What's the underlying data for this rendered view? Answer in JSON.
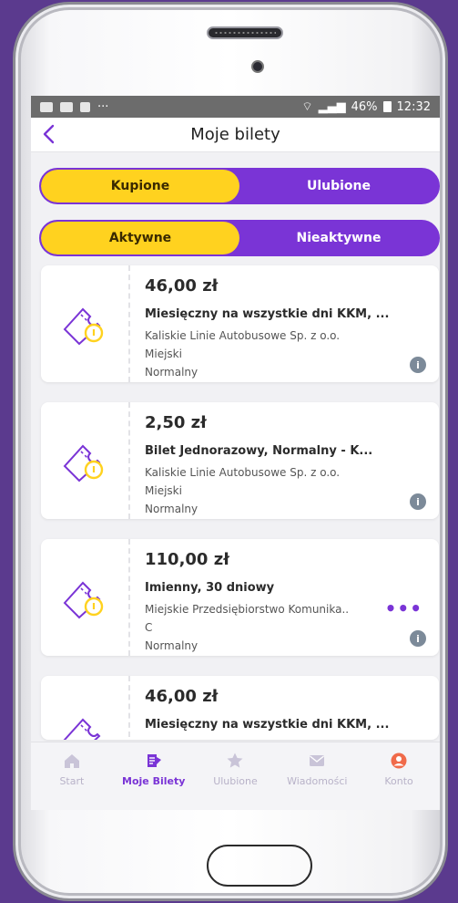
{
  "status_bar": {
    "battery": "46%",
    "time": "12:32",
    "icons": [
      "gallery-icon",
      "message-icon",
      "shopping-bag-icon",
      "more-icon",
      "wifi-icon",
      "signal-icon",
      "battery-icon"
    ]
  },
  "header": {
    "title": "Moje bilety",
    "back_icon": "chevron-left-icon"
  },
  "segment_primary": {
    "options": [
      "Kupione",
      "Ulubione"
    ],
    "selected": "Kupione"
  },
  "segment_secondary": {
    "options": [
      "Aktywne",
      "Nieaktywne"
    ],
    "selected": "Aktywne"
  },
  "tickets": [
    {
      "price": "46,00 zł",
      "name": "Miesięczny na wszystkie dni KKM, ...",
      "operator": "Kaliskie Linie Autobusowe Sp. z o.o.",
      "zone": "Miejski",
      "tariff": "Normalny",
      "info": "i"
    },
    {
      "price": "2,50 zł",
      "name": "Bilet Jednorazowy, Normalny - K...",
      "operator": "Kaliskie Linie Autobusowe Sp. z o.o.",
      "zone": "Miejski",
      "tariff": "Normalny",
      "info": "i"
    },
    {
      "price": "110,00 zł",
      "name": "Imienny, 30 dniowy",
      "operator": "Miejskie Przedsiębiorstwo Komunika..",
      "zone": "C",
      "tariff": "Normalny",
      "info": "i",
      "more": "•••"
    },
    {
      "price": "46,00 zł",
      "name": "Miesięczny na wszystkie dni KKM, ..."
    }
  ],
  "bottom_nav": {
    "items": [
      {
        "label": "Start",
        "icon": "home-icon"
      },
      {
        "label": "Moje Bilety",
        "icon": "tickets-icon"
      },
      {
        "label": "Ulubione",
        "icon": "star-icon"
      },
      {
        "label": "Wiadomości",
        "icon": "mail-icon"
      },
      {
        "label": "Konto",
        "icon": "account-icon"
      }
    ],
    "active": "Moje Bilety"
  },
  "colors": {
    "accent": "#7a34d6",
    "highlight": "#ffd21f",
    "background": "#5b3a8e"
  }
}
